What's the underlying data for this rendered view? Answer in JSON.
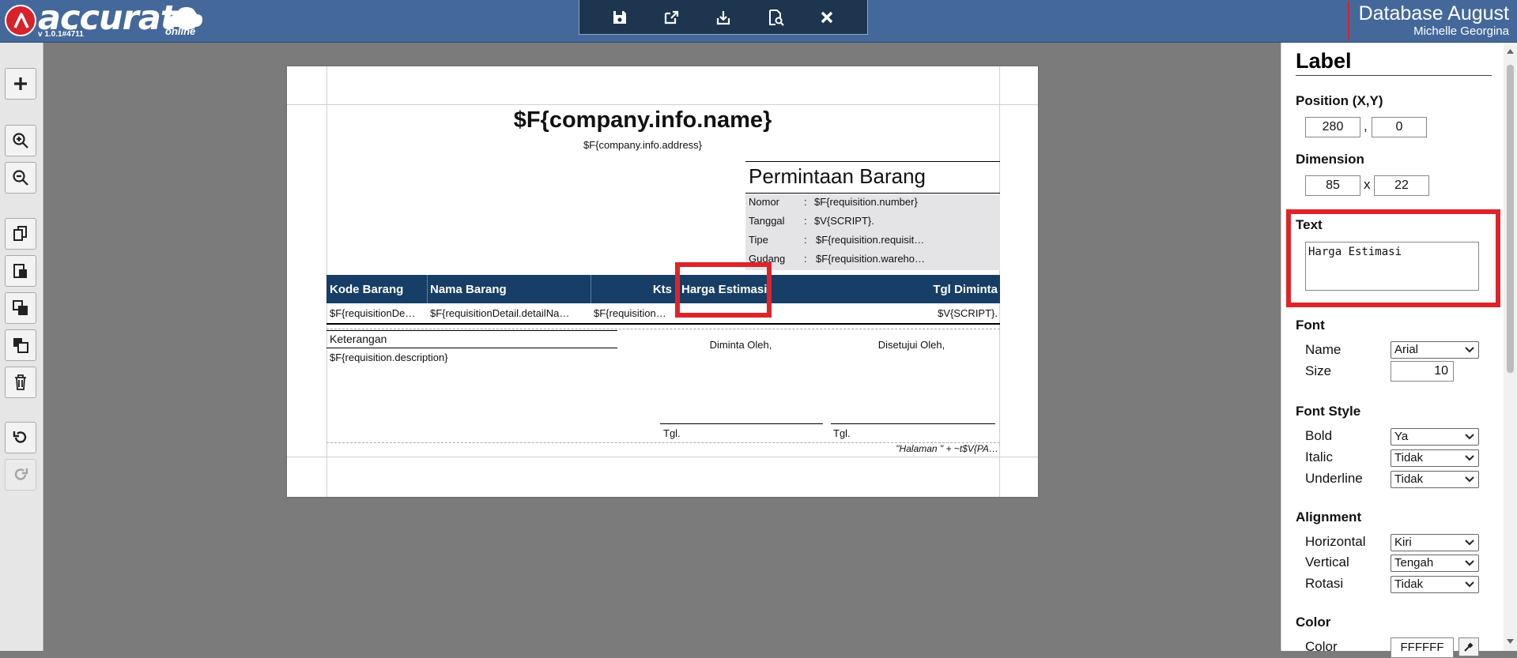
{
  "app": {
    "logo_text": "accurate",
    "logo_sub": "online",
    "version": "v 1.0.1#4711"
  },
  "header": {
    "database_name": "Database August",
    "user_name": "Michelle Georgina"
  },
  "toolbar": {
    "icons": [
      "save-icon",
      "export-icon",
      "download-icon",
      "preview-icon",
      "close-icon"
    ]
  },
  "left_toolbar": {
    "icons": [
      "add-icon",
      "zoom-in-icon",
      "zoom-out-icon",
      "copy-icon",
      "paste-icon",
      "bring-front-icon",
      "send-back-icon",
      "delete-icon",
      "undo-icon",
      "redo-icon"
    ]
  },
  "report": {
    "company_name": "$F{company.info.name}",
    "company_address": "$F{company.info.address}",
    "doc_title": "Permintaan Barang",
    "fields": [
      {
        "label": "Nomor",
        "sep": ":",
        "value": "$F{requisition.number}"
      },
      {
        "label": "Tanggal",
        "sep": ":",
        "value": "$V{SCRIPT}."
      },
      {
        "label": "Tipe",
        "sep": ":",
        "value": "$F{requisition.requisit…"
      },
      {
        "label": "Gudang",
        "sep": ":",
        "value": "$F{requisition.wareho…"
      }
    ],
    "table_headers": [
      "Kode Barang",
      "Nama Barang",
      "Kts",
      "Harga Estimasi",
      "Tgl Diminta"
    ],
    "table_row": [
      "$F{requisitionDe…",
      "$F{requisitionDetail.detailNa…",
      "$F{requisition…",
      "$V{SCRIPT}."
    ],
    "keterangan_label": "Keterangan",
    "keterangan_value": "$F{requisition.description}",
    "diminta_oleh": "Diminta Oleh,",
    "disetujui_oleh": "Disetujui Oleh,",
    "tgl1": "Tgl.",
    "tgl2": "Tgl.",
    "footer_page": "\"Halaman \" + ~t$V{PA…"
  },
  "panel": {
    "title": "Label",
    "position_label": "Position (X,Y)",
    "pos_x": "280",
    "pos_sep": ",",
    "pos_y": "0",
    "dimension_label": "Dimension",
    "dim_w": "85",
    "dim_sep": "x",
    "dim_h": "22",
    "text_label": "Text",
    "text_value": "Harga Estimasi",
    "font_label": "Font",
    "font_name_label": "Name",
    "font_name": "Arial",
    "font_size_label": "Size",
    "font_size": "10",
    "font_style_label": "Font Style",
    "bold_label": "Bold",
    "bold": "Ya",
    "italic_label": "Italic",
    "italic": "Tidak",
    "underline_label": "Underline",
    "underline": "Tidak",
    "alignment_label": "Alignment",
    "horizontal_label": "Horizontal",
    "horizontal": "Kiri",
    "vertical_label": "Vertical",
    "vertical": "Tengah",
    "rotasi_label": "Rotasi",
    "rotasi": "Tidak",
    "color_label": "Color",
    "color_sub_label": "Color",
    "color_value": "FFFFFF"
  },
  "colors": {
    "topbar": "#44689a",
    "table_header": "#173e66",
    "highlight": "#e0232a",
    "field_bg": "#e4e4e7"
  }
}
